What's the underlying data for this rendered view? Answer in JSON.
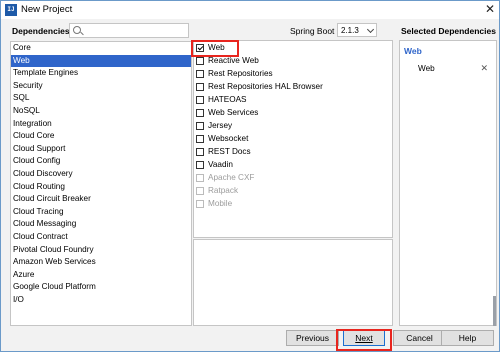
{
  "window": {
    "title": "New Project"
  },
  "left": {
    "heading": "Dependencies",
    "search": {
      "value": "",
      "placeholder": ""
    },
    "categories": [
      "Core",
      "Web",
      "Template Engines",
      "Security",
      "SQL",
      "NoSQL",
      "Integration",
      "Cloud Core",
      "Cloud Support",
      "Cloud Config",
      "Cloud Discovery",
      "Cloud Routing",
      "Cloud Circuit Breaker",
      "Cloud Tracing",
      "Cloud Messaging",
      "Cloud Contract",
      "Pivotal Cloud Foundry",
      "Amazon Web Services",
      "Azure",
      "Google Cloud Platform",
      "I/O"
    ],
    "selected_index": 1
  },
  "middle": {
    "spring_boot_label": "Spring Boot",
    "spring_boot_version": "2.1.3",
    "dependencies": [
      {
        "label": "Web",
        "checked": true,
        "enabled": true
      },
      {
        "label": "Reactive Web",
        "checked": false,
        "enabled": true
      },
      {
        "label": "Rest Repositories",
        "checked": false,
        "enabled": true
      },
      {
        "label": "Rest Repositories HAL Browser",
        "checked": false,
        "enabled": true
      },
      {
        "label": "HATEOAS",
        "checked": false,
        "enabled": true
      },
      {
        "label": "Web Services",
        "checked": false,
        "enabled": true
      },
      {
        "label": "Jersey",
        "checked": false,
        "enabled": true
      },
      {
        "label": "Websocket",
        "checked": false,
        "enabled": true
      },
      {
        "label": "REST Docs",
        "checked": false,
        "enabled": true
      },
      {
        "label": "Vaadin",
        "checked": false,
        "enabled": true
      },
      {
        "label": "Apache CXF",
        "checked": false,
        "enabled": false
      },
      {
        "label": "Ratpack",
        "checked": false,
        "enabled": false
      },
      {
        "label": "Mobile",
        "checked": false,
        "enabled": false
      }
    ]
  },
  "right": {
    "heading": "Selected Dependencies",
    "group": "Web",
    "items": [
      "Web"
    ],
    "remove_icon": "close-icon"
  },
  "footer": {
    "previous": "Previous",
    "next": "Next",
    "cancel": "Cancel",
    "help": "Help"
  },
  "colors": {
    "selection": "#2f65ca",
    "highlight": "#e8251e"
  }
}
